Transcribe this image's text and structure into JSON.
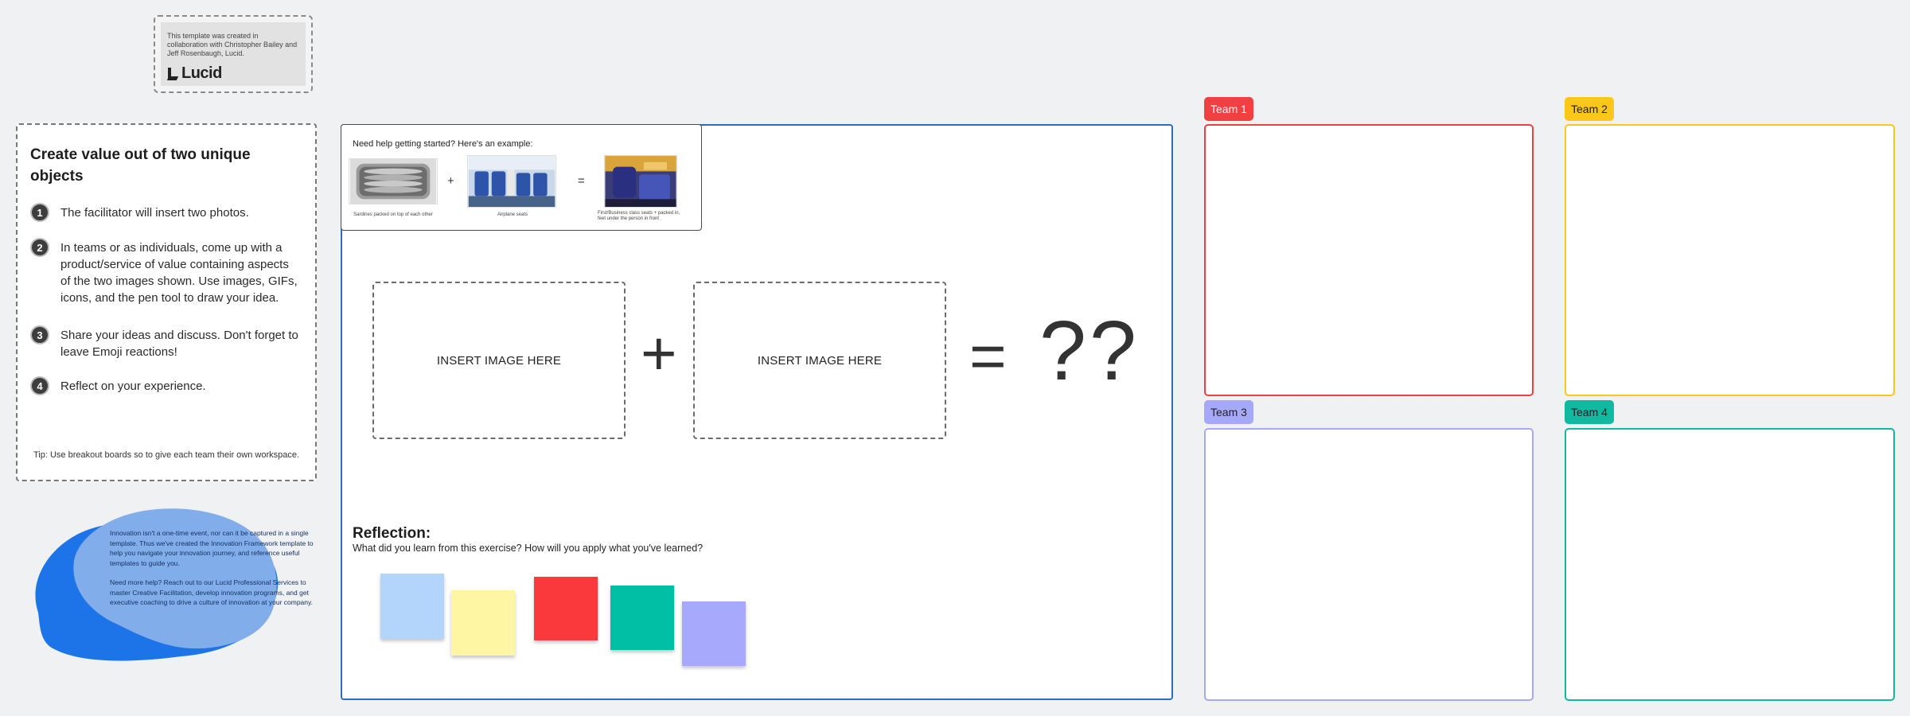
{
  "credit": {
    "text": "This template was created in collaboration with Christopher Bailey and Jeff Rosenbaugh, Lucid.",
    "logo_text": "Lucid"
  },
  "instructions": {
    "title": "Create value out of two unique objects",
    "steps": [
      {
        "number": "1",
        "text": "The facilitator will insert two photos."
      },
      {
        "number": "2",
        "text": "In teams or as individuals, come up with a product/service of value containing aspects of the two images shown. Use images, GIFs, icons, and the pen tool to draw your idea."
      },
      {
        "number": "3",
        "text": "Share your ideas and discuss. Don't forget to leave Emoji reactions!"
      },
      {
        "number": "4",
        "text": "Reflect on your experience."
      }
    ],
    "tip": "Tip: Use breakout boards so to give each team their own workspace."
  },
  "blob": {
    "paragraph1": "Innovation isn't a one-time event, nor can it be captured in a single template. Thus we've created the Innovation Framework template to help you navigate your innovation journey, and reference useful templates to guide you.",
    "paragraph2": "Need more help? Reach out to our Lucid Professional Services to master Creative Facilitation, develop innovation programs, and get executive coaching to drive a culture of innovation at your company."
  },
  "example": {
    "title": "Need help getting started? Here's an example:",
    "caption1": "Sardines packed on top of each other",
    "caption2": "Airplane seats",
    "caption3": "First/Business class seats + packed in, feet under the person in front",
    "plus": "+",
    "equals": "="
  },
  "canvas": {
    "insert_label_1": "INSERT IMAGE HERE",
    "insert_label_2": "INSERT IMAGE HERE",
    "plus": "+",
    "equals": "=",
    "result": "??",
    "reflection_title": "Reflection:",
    "reflection_prompt": "What did you learn from this exercise?   How will you apply what you've learned?"
  },
  "stickies": {
    "colors": [
      "#b3d4fb",
      "#fff6a3",
      "#f9393b",
      "#00bfa5",
      "#a6a9fc"
    ]
  },
  "teams": [
    {
      "label": "Team 1",
      "color": "#f23f42",
      "text_color": "#ffffff"
    },
    {
      "label": "Team 2",
      "color": "#fcc719",
      "text_color": "#222222"
    },
    {
      "label": "Team 3",
      "color": "#a5a8fb",
      "text_color": "#222222"
    },
    {
      "label": "Team 4",
      "color": "#11b9a0",
      "text_color": "#222222"
    }
  ]
}
